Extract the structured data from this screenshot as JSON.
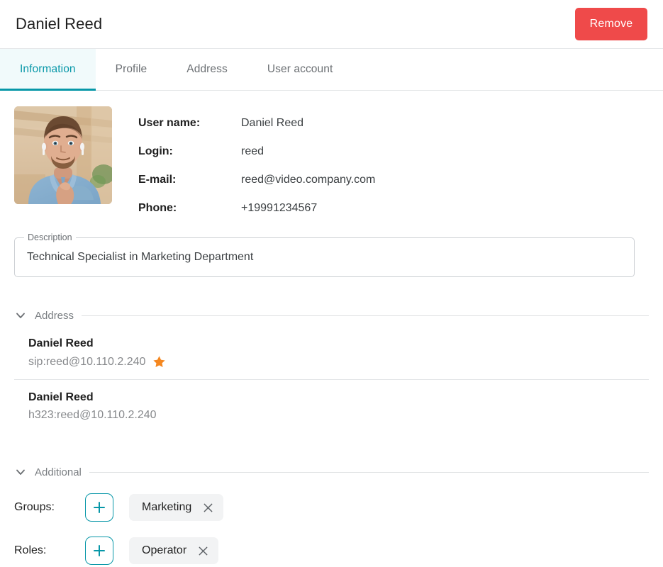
{
  "header": {
    "title": "Daniel Reed",
    "remove_label": "Remove"
  },
  "tabs": [
    {
      "label": "Information",
      "active": true
    },
    {
      "label": "Profile",
      "active": false
    },
    {
      "label": "Address",
      "active": false
    },
    {
      "label": "User account",
      "active": false
    }
  ],
  "avatar": {
    "icon": "user-photo",
    "alt": "Daniel Reed photo"
  },
  "fields": [
    {
      "label": "User name:",
      "value": "Daniel Reed"
    },
    {
      "label": "Login:",
      "value": "reed"
    },
    {
      "label": "E-mail:",
      "value": "reed@video.company.com"
    },
    {
      "label": "Phone:",
      "value": "+19991234567"
    }
  ],
  "description": {
    "legend": "Description",
    "value": "Technical Specialist in Marketing Department"
  },
  "address_section": {
    "title": "Address",
    "chevron": "chevron-down-icon",
    "items": [
      {
        "name": "Daniel Reed",
        "uri": "sip:reed@10.110.2.240",
        "favorite": true
      },
      {
        "name": "Daniel Reed",
        "uri": "h323:reed@10.110.2.240",
        "favorite": false
      }
    ]
  },
  "additional_section": {
    "title": "Additional",
    "chevron": "chevron-down-icon",
    "groups": {
      "label": "Groups:",
      "add_icon": "plus-icon",
      "chips": [
        {
          "label": "Marketing",
          "remove_icon": "close-icon"
        }
      ]
    },
    "roles": {
      "label": "Roles:",
      "add_icon": "plus-icon",
      "chips": [
        {
          "label": "Operator",
          "remove_icon": "close-icon"
        }
      ]
    }
  },
  "colors": {
    "accent": "#0797a8",
    "danger": "#ef4a4a",
    "favorite": "#f5871f",
    "chip_bg": "#f2f3f4",
    "border": "#e4e6e8"
  }
}
